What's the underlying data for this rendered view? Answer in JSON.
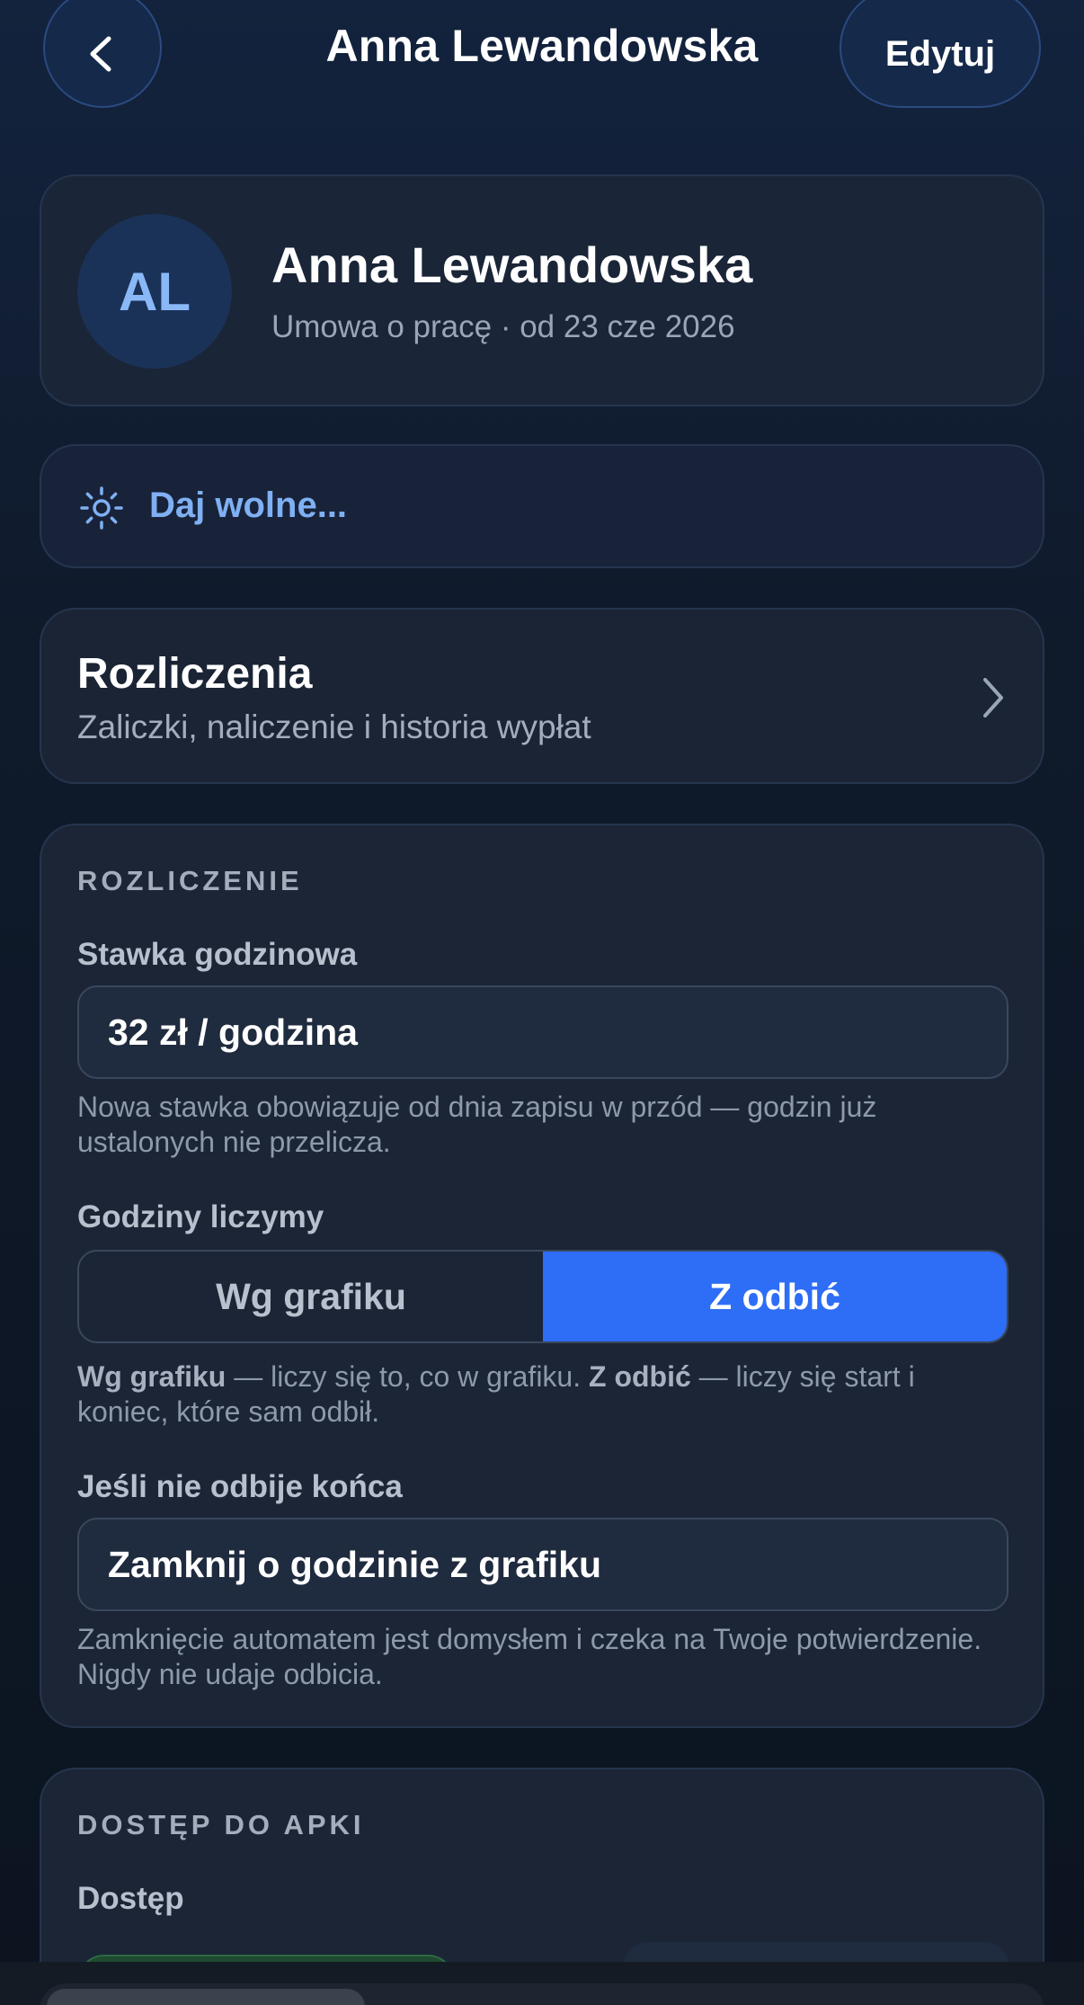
{
  "header": {
    "title": "Anna Lewandowska",
    "edit_label": "Edytuj"
  },
  "profile": {
    "initials": "AL",
    "name": "Anna Lewandowska",
    "subtitle": "Umowa o pracę · od 23 cze 2026",
    "avatar_color": "#1b3258",
    "initials_color": "#8ab8f7"
  },
  "time_off": {
    "label": "Daj wolne...",
    "icon": "sun-icon",
    "color": "#7fb0f3"
  },
  "settlements": {
    "title": "Rozliczenia",
    "subtitle": "Zaliczki, naliczenie i historia wypłat"
  },
  "billing": {
    "section_label": "ROZLICZENIE",
    "rate_label": "Stawka godzinowa",
    "rate_value": "32 zł / godzina",
    "rate_hint": "Nowa stawka obowiązuje od dnia zapisu w przód — godzin już ustalonych nie przelicza.",
    "hours_label": "Godziny liczymy",
    "hours_options": [
      "Wg grafiku",
      "Z odbić"
    ],
    "hours_selected": "Z odbić",
    "hours_hint_a_bold": "Wg grafiku",
    "hours_hint_a": " — liczy się to, co w grafiku. ",
    "hours_hint_b_bold": "Z odbić",
    "hours_hint_b": " — liczy się start i koniec, które sam odbił.",
    "missing_end_label": "Jeśli nie odbije końca",
    "missing_end_value": "Zamknij o godzinie z grafiku",
    "missing_end_hint": "Zamknięcie automatem jest domysłem i czeka na Twoje potwierdzenie. Nigdy nie udaje odbicia.",
    "accent_color": "#2e6df6"
  },
  "access": {
    "section_label": "DOSTĘP DO APKI",
    "access_label": "Dostęp"
  }
}
